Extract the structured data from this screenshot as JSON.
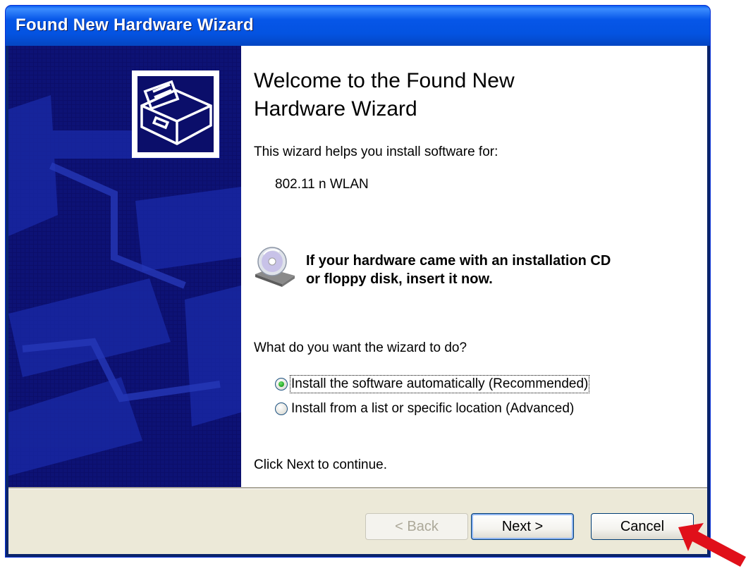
{
  "window": {
    "title": "Found New Hardware Wizard"
  },
  "content": {
    "heading_line1": "Welcome to the Found New",
    "heading_line2": "Hardware Wizard",
    "intro": "This wizard helps you install software for:",
    "device_name": "802.11 n WLAN",
    "cd_prompt_line1": "If your hardware came with an installation CD",
    "cd_prompt_line2": "or floppy disk, insert it now.",
    "question": "What do you want the wizard to do?",
    "options": [
      {
        "label": "Install the software automatically (Recommended)",
        "selected": true
      },
      {
        "label": "Install from a list or specific location (Advanced)",
        "selected": false
      }
    ],
    "continue_text": "Click Next to continue."
  },
  "buttons": {
    "back": "< Back",
    "next": "Next >",
    "cancel": "Cancel"
  },
  "colors": {
    "title_bar": "#0453e1",
    "banner": "#0b0e6a",
    "face": "#ece9d8",
    "arrow": "#e0101a"
  },
  "icons": [
    "hardware-install-icon",
    "cd-drive-icon",
    "red-arrow-annotation"
  ]
}
